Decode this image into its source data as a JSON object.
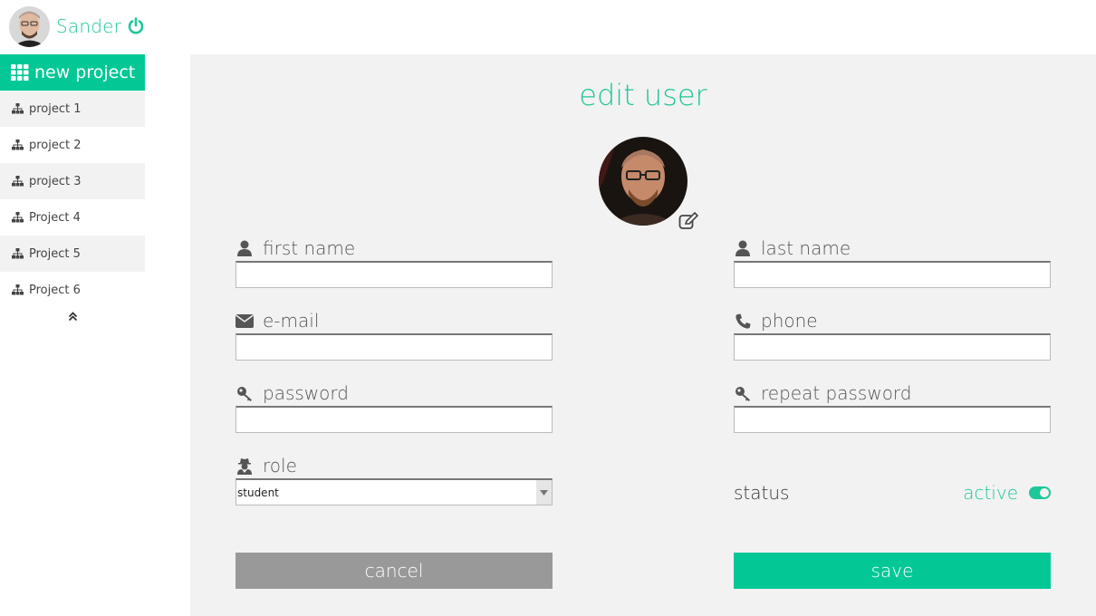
{
  "user": {
    "name": "Sander"
  },
  "sidebar": {
    "new_project_label": "new project",
    "projects": [
      {
        "label": "project 1"
      },
      {
        "label": "project 2"
      },
      {
        "label": "project 3"
      },
      {
        "label": "Project 4"
      },
      {
        "label": "Project 5"
      },
      {
        "label": "Project 6"
      }
    ]
  },
  "form": {
    "title": "edit user",
    "first_name": {
      "label": "first name",
      "value": ""
    },
    "last_name": {
      "label": "last name",
      "value": ""
    },
    "email": {
      "label": "e-mail",
      "value": ""
    },
    "phone": {
      "label": "phone",
      "value": ""
    },
    "password": {
      "label": "password",
      "value": ""
    },
    "repeat_password": {
      "label": "repeat password",
      "value": ""
    },
    "role": {
      "label": "role",
      "selected": "student"
    },
    "status": {
      "label": "status",
      "value": "active",
      "enabled": true
    },
    "cancel_label": "cancel",
    "save_label": "save"
  },
  "colors": {
    "accent": "#03c896",
    "accent_text": "#1fc79a",
    "panel_bg": "#f2f2f2",
    "cancel_bg": "#999999"
  },
  "icons": {
    "power": "power-icon",
    "grid": "grid-icon",
    "project": "sitemap-icon",
    "collapse": "double-chevron-up-icon",
    "edit": "edit-icon",
    "user": "user-icon",
    "email": "envelope-icon",
    "phone": "phone-icon",
    "password": "key-icon",
    "role": "user-secret-icon"
  }
}
